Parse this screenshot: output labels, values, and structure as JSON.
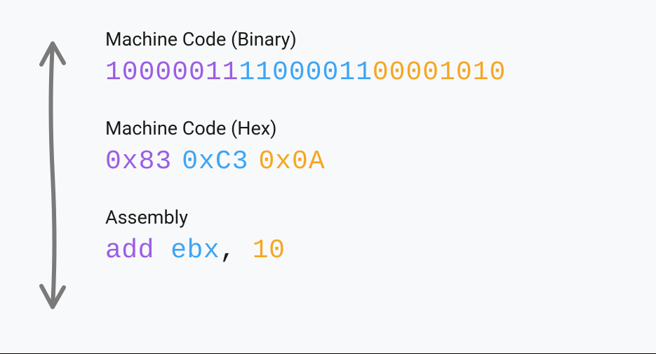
{
  "sections": {
    "binary": {
      "label": "Machine Code (Binary)",
      "parts": {
        "p1": "10000011",
        "p2": "11000011",
        "p3": "00001010"
      }
    },
    "hex": {
      "label": "Machine Code (Hex)",
      "parts": {
        "p1": "0x83",
        "p2": "0xC3",
        "p3": "0x0A"
      }
    },
    "assembly": {
      "label": "Assembly",
      "parts": {
        "mnemonic": "add",
        "reg": "ebx",
        "comma": ",",
        "imm": "10"
      }
    }
  },
  "colors": {
    "purple": "#9B5DE5",
    "blue": "#3DA5F5",
    "orange": "#F5A623"
  }
}
